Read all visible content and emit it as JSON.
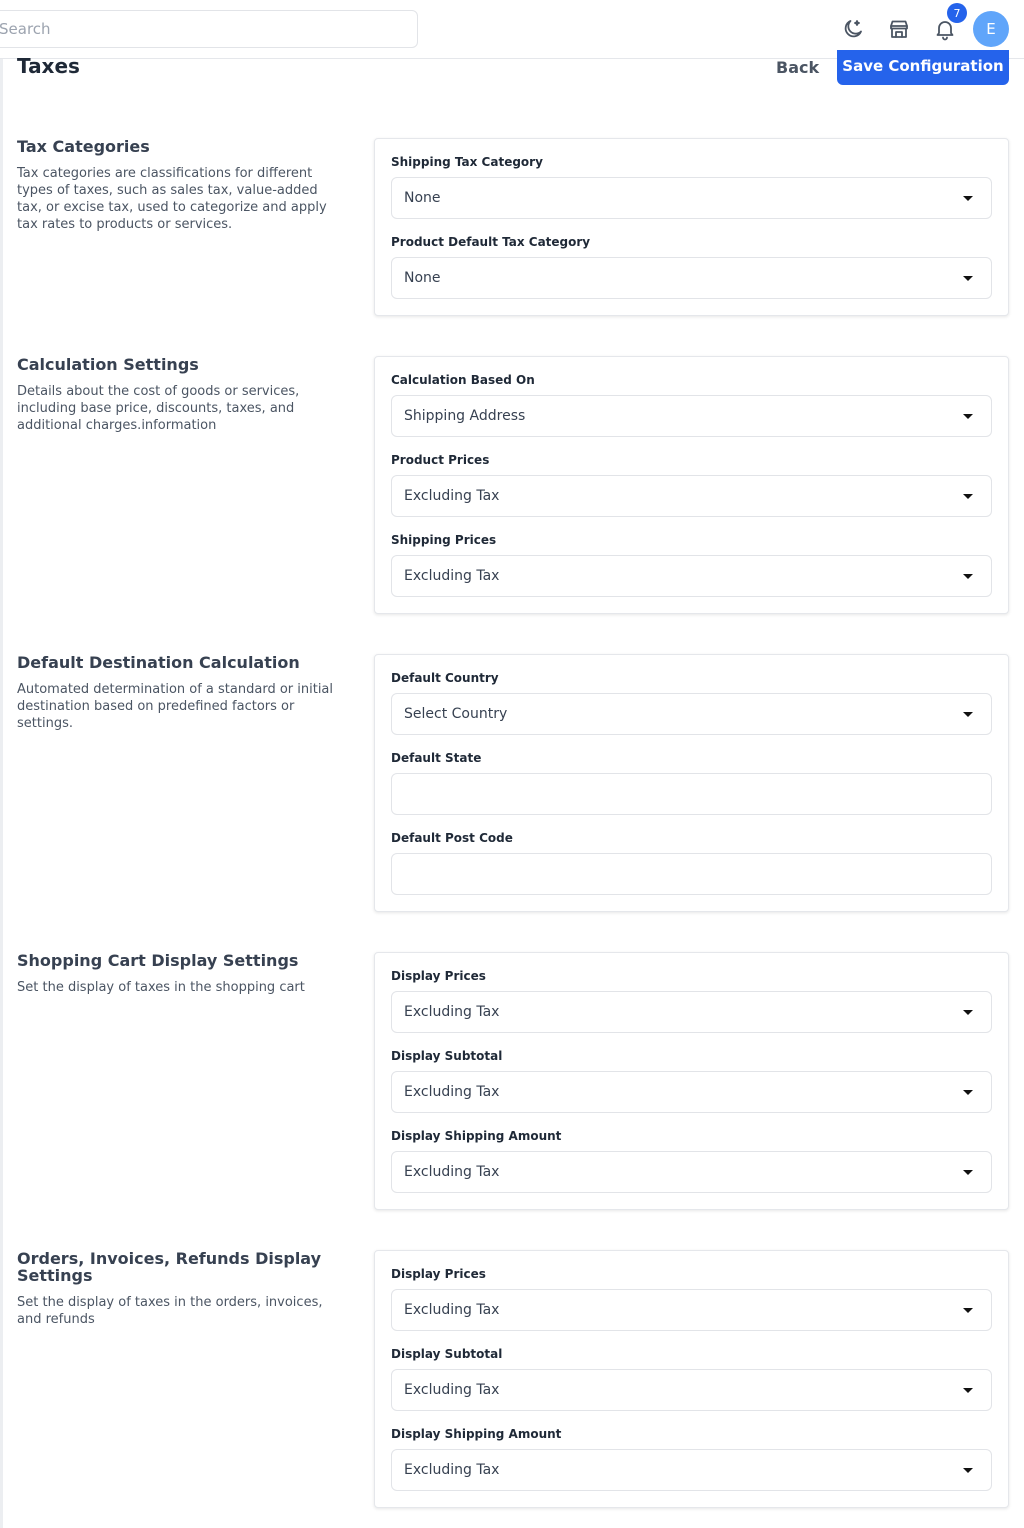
{
  "topbar": {
    "search_placeholder": "Search",
    "notifications_count": "7",
    "avatar_initial": "E"
  },
  "page": {
    "title": "Taxes",
    "back_label": "Back",
    "save_label": "Save Configuration"
  },
  "sections": [
    {
      "title": "Tax Categories",
      "description": "Tax categories are classifications for different types of taxes, such as sales tax, value-added tax, or excise tax, used to categorize and apply tax rates to products or services.",
      "fields": [
        {
          "label": "Shipping Tax Category",
          "type": "select",
          "value": "None"
        },
        {
          "label": "Product Default Tax Category",
          "type": "select",
          "value": "None"
        }
      ]
    },
    {
      "title": "Calculation Settings",
      "description": "Details about the cost of goods or services, including base price, discounts, taxes, and additional charges.information",
      "fields": [
        {
          "label": "Calculation Based On",
          "type": "select",
          "value": "Shipping Address"
        },
        {
          "label": "Product Prices",
          "type": "select",
          "value": "Excluding Tax"
        },
        {
          "label": "Shipping Prices",
          "type": "select",
          "value": "Excluding Tax"
        }
      ]
    },
    {
      "title": "Default Destination Calculation",
      "description": "Automated determination of a standard or initial destination based on predefined factors or settings.",
      "fields": [
        {
          "label": "Default Country",
          "type": "select",
          "value": "Select Country"
        },
        {
          "label": "Default State",
          "type": "text",
          "value": ""
        },
        {
          "label": "Default Post Code",
          "type": "text",
          "value": ""
        }
      ]
    },
    {
      "title": "Shopping Cart Display Settings",
      "description": "Set the display of taxes in the shopping cart",
      "fields": [
        {
          "label": "Display Prices",
          "type": "select",
          "value": "Excluding Tax"
        },
        {
          "label": "Display Subtotal",
          "type": "select",
          "value": "Excluding Tax"
        },
        {
          "label": "Display Shipping Amount",
          "type": "select",
          "value": "Excluding Tax"
        }
      ]
    },
    {
      "title": "Orders, Invoices, Refunds Display Settings",
      "description": "Set the display of taxes in the orders, invoices, and refunds",
      "fields": [
        {
          "label": "Display Prices",
          "type": "select",
          "value": "Excluding Tax"
        },
        {
          "label": "Display Subtotal",
          "type": "select",
          "value": "Excluding Tax"
        },
        {
          "label": "Display Shipping Amount",
          "type": "select",
          "value": "Excluding Tax"
        }
      ]
    }
  ],
  "colors": {
    "accent": "#2563eb",
    "avatar": "#60a5fa"
  }
}
